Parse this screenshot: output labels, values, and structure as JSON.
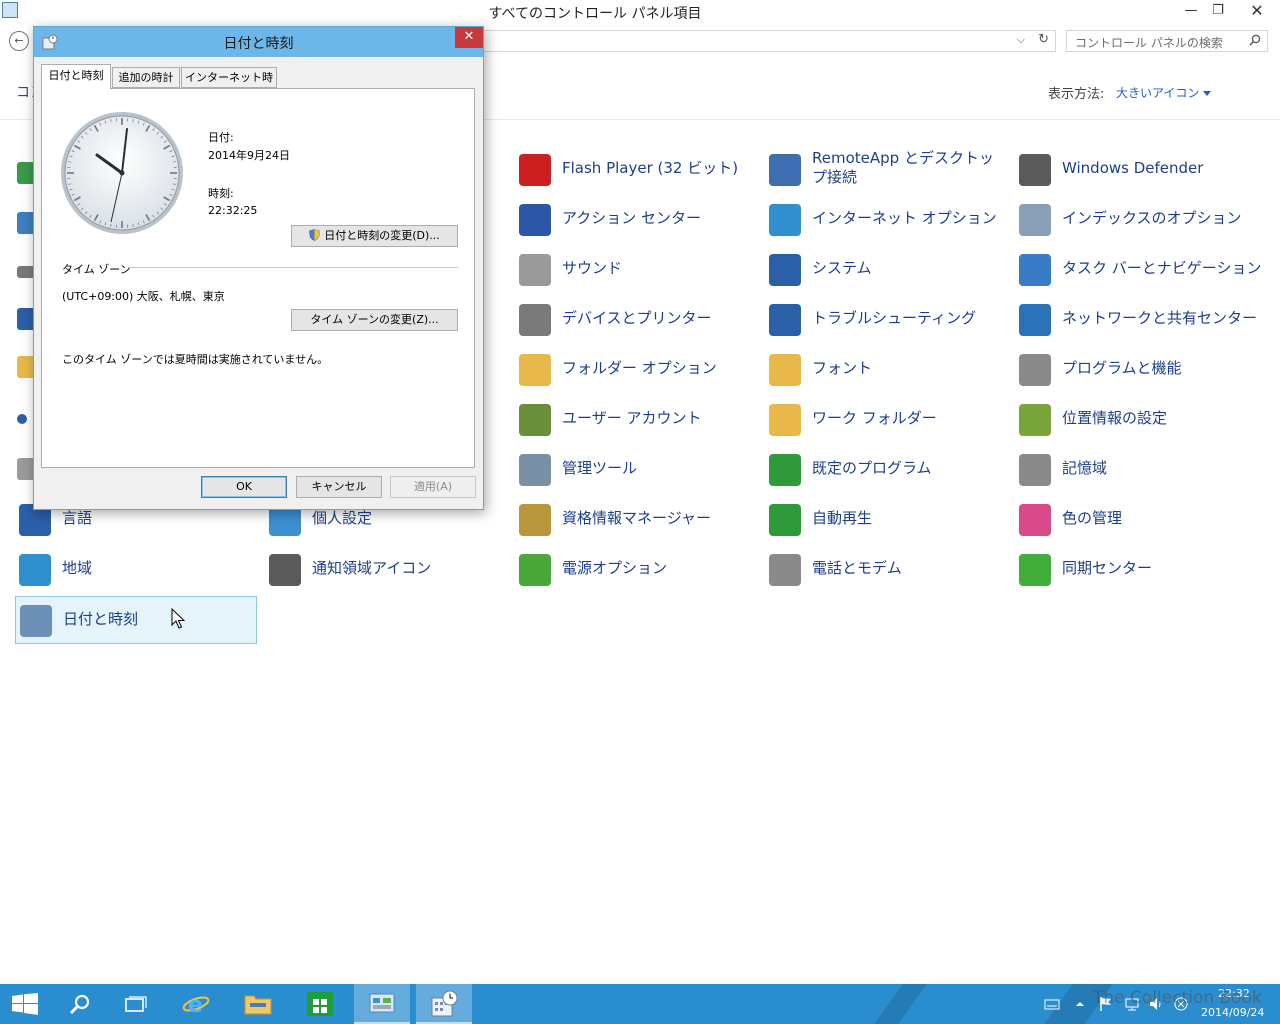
{
  "window": {
    "title": "すべてのコントロール パネル項目",
    "min": "—",
    "restore": "❐",
    "close": "✕"
  },
  "nav": {
    "back": "←",
    "search_placeholder": "コントロール パネルの検索",
    "breadcrumb": "コン"
  },
  "view": {
    "label": "表示方法:",
    "value": "大きいアイコン"
  },
  "items": [
    {
      "label": "Flash Player (32 ビット)",
      "icon": "flash-player-icon",
      "color": "#cc1f1f"
    },
    {
      "label": "RemoteApp とデスクトップ接続",
      "icon": "remoteapp-icon",
      "color": "#3d6fb0"
    },
    {
      "label": "Windows Defender",
      "icon": "windows-defender-icon",
      "color": "#5a5a5a"
    },
    {
      "label": "アクション センター",
      "icon": "action-center-flag-icon",
      "color": "#2c56a8"
    },
    {
      "label": "インターネット オプション",
      "icon": "internet-options-icon",
      "color": "#2f8fcf"
    },
    {
      "label": "インデックスのオプション",
      "icon": "indexing-options-icon",
      "color": "#8aa0b8"
    },
    {
      "label": "サウンド",
      "icon": "sound-speaker-icon",
      "color": "#9a9a9a"
    },
    {
      "label": "システム",
      "icon": "system-icon",
      "color": "#2b5fa8"
    },
    {
      "label": "タスク バーとナビゲーション",
      "icon": "taskbar-navigation-icon",
      "color": "#3a7bc8"
    },
    {
      "label": "デバイスとプリンター",
      "icon": "devices-printers-icon",
      "color": "#7a7a7a"
    },
    {
      "label": "トラブルシューティング",
      "icon": "troubleshooting-icon",
      "color": "#2b5fa8"
    },
    {
      "label": "ネットワークと共有センター",
      "icon": "network-sharing-icon",
      "color": "#2b72b8"
    },
    {
      "label": "フォルダー オプション",
      "icon": "folder-options-icon",
      "color": "#e8b84a"
    },
    {
      "label": "フォント",
      "icon": "fonts-icon",
      "color": "#e8b84a"
    },
    {
      "label": "プログラムと機能",
      "icon": "programs-features-icon",
      "color": "#8a8a8a"
    },
    {
      "label": "ユーザー アカウント",
      "icon": "user-accounts-icon",
      "color": "#6b8e3a"
    },
    {
      "label": "ワーク フォルダー",
      "icon": "work-folders-icon",
      "color": "#e8b84a"
    },
    {
      "label": "位置情報の設定",
      "icon": "location-settings-icon",
      "color": "#7aa53a"
    },
    {
      "label": "管理ツール",
      "icon": "admin-tools-icon",
      "color": "#7a8fa8"
    },
    {
      "label": "既定のプログラム",
      "icon": "default-programs-icon",
      "color": "#2e9a3a"
    },
    {
      "label": "記憶域",
      "icon": "storage-spaces-icon",
      "color": "#8a8a8a"
    },
    {
      "label": "言語",
      "icon": "language-icon",
      "color": "#2b5fa8"
    },
    {
      "label": "個人設定",
      "icon": "personalization-icon",
      "color": "#3d8fd0"
    },
    {
      "label": "資格情報マネージャー",
      "icon": "credential-manager-icon",
      "color": "#b8963a"
    },
    {
      "label": "自動再生",
      "icon": "autoplay-icon",
      "color": "#2e9a3a"
    },
    {
      "label": "色の管理",
      "icon": "color-management-icon",
      "color": "#d84a8a"
    },
    {
      "label": "地域",
      "icon": "region-globe-icon",
      "color": "#2f8fcf"
    },
    {
      "label": "通知領域アイコン",
      "icon": "notification-area-icon",
      "color": "#5a5a5a"
    },
    {
      "label": "電源オプション",
      "icon": "power-options-icon",
      "color": "#4aa83a"
    },
    {
      "label": "電話とモデム",
      "icon": "phone-modem-icon",
      "color": "#8a8a8a"
    },
    {
      "label": "同期センター",
      "icon": "sync-center-icon",
      "color": "#3fae3a"
    },
    {
      "label": "日付と時刻",
      "icon": "date-time-icon",
      "color": "#6a90b8"
    }
  ],
  "dialog": {
    "title": "日付と時刻",
    "close": "✕",
    "tabs": [
      "日付と時刻",
      "追加の時計",
      "インターネット時刻"
    ],
    "date_label": "日付:",
    "date_value": "2014年9月24日",
    "time_label": "時刻:",
    "time_value": "22:32:25",
    "change_datetime_button": "日付と時刻の変更(D)...",
    "timezone_section": "タイム ゾーン",
    "timezone_value": "(UTC+09:00) 大阪、札幌、東京",
    "change_timezone_button": "タイム ゾーンの変更(Z)...",
    "dst_note": "このタイム ゾーンでは夏時間は実施されていません。",
    "ok": "OK",
    "cancel": "キャンセル",
    "apply": "適用(A)"
  },
  "taskbar": {
    "time": "22:32",
    "date": "2014/09/24",
    "watermark": "The Collection Book"
  }
}
